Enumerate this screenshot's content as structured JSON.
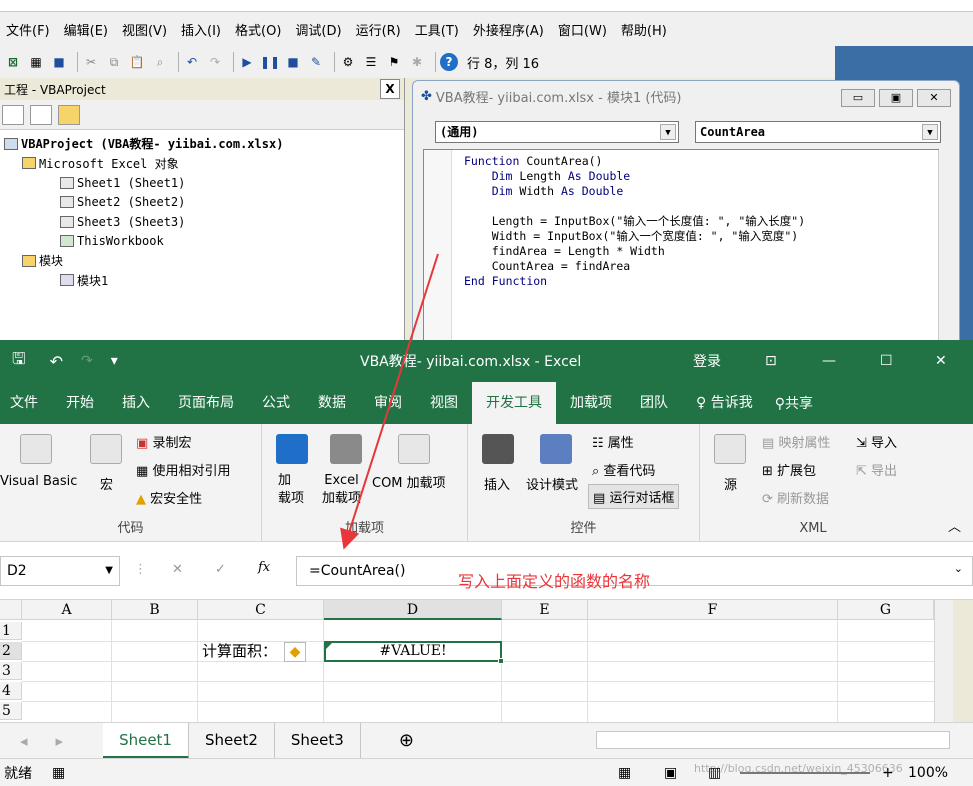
{
  "vbe": {
    "menu": [
      "文件(F)",
      "编辑(E)",
      "视图(V)",
      "插入(I)",
      "格式(O)",
      "调试(D)",
      "运行(R)",
      "工具(T)",
      "外接程序(A)",
      "窗口(W)",
      "帮助(H)"
    ],
    "cursor_pos": "行 8，列 16",
    "project_panel": {
      "title": "工程 - VBAProject",
      "close_label": "X",
      "tree": [
        {
          "label": "VBAProject (VBA教程-  yiibai.com.xlsx)",
          "indent": 0,
          "bold": true
        },
        {
          "label": "Microsoft Excel 对象",
          "indent": 1
        },
        {
          "label": "Sheet1 (Sheet1)",
          "indent": 2
        },
        {
          "label": "Sheet2 (Sheet2)",
          "indent": 2
        },
        {
          "label": "Sheet3 (Sheet3)",
          "indent": 2
        },
        {
          "label": "ThisWorkbook",
          "indent": 2
        },
        {
          "label": "模块",
          "indent": 1
        },
        {
          "label": "模块1",
          "indent": 2
        }
      ]
    },
    "code_window": {
      "title": "VBA教程-  yiibai.com.xlsx - 模块1 (代码)",
      "object_select": "(通用)",
      "proc_select": "CountArea",
      "code_lines": [
        "Function CountArea()",
        "    Dim Length As Double",
        "    Dim Width As Double",
        "",
        "    Length = InputBox(\"输入一个长度值: \", \"输入长度\")",
        "    Width = InputBox(\"输入一个宽度值: \", \"输入宽度\")",
        "    findArea = Length * Width",
        "    CountArea = findArea",
        "End Function"
      ]
    }
  },
  "excel": {
    "title": "VBA教程-  yiibai.com.xlsx  -  Excel",
    "login": "登录",
    "tabs": [
      "文件",
      "开始",
      "插入",
      "页面布局",
      "公式",
      "数据",
      "审阅",
      "视图",
      "开发工具",
      "加载项",
      "团队"
    ],
    "tell_me": "♀ 告诉我",
    "share": "共享",
    "groups": {
      "code": {
        "label": "代码",
        "visual_basic": "Visual Basic",
        "macro": "宏",
        "record": "录制宏",
        "relative": "使用相对引用",
        "security": "宏安全性"
      },
      "addins": {
        "label": "加载项",
        "addin": "加\n载项",
        "excel_addin": "Excel\n加载项",
        "com_addin": "COM 加载项"
      },
      "controls": {
        "label": "控件",
        "insert": "插入",
        "design": "设计模式",
        "properties": "属性",
        "view_code": "查看代码",
        "run_dialog": "运行对话框"
      },
      "xml": {
        "label": "XML",
        "source": "源",
        "map_props": "映射属性",
        "expansion": "扩展包",
        "refresh": "刷新数据",
        "import": "导入",
        "export": "导出"
      }
    },
    "name_box": "D2",
    "formula": "=CountArea()",
    "formula_annotation": "写入上面定义的函数的名称",
    "columns": [
      "A",
      "B",
      "C",
      "D",
      "E",
      "F",
      "G"
    ],
    "rows": [
      "1",
      "2",
      "3",
      "4",
      "5"
    ],
    "cells": {
      "C2": "计算面积：",
      "D2": "#VALUE!"
    },
    "sheets": [
      "Sheet1",
      "Sheet2",
      "Sheet3"
    ],
    "status": "就绪",
    "zoom": "100%",
    "watermark": "http://blog.csdn.net/weixin_45306636"
  }
}
